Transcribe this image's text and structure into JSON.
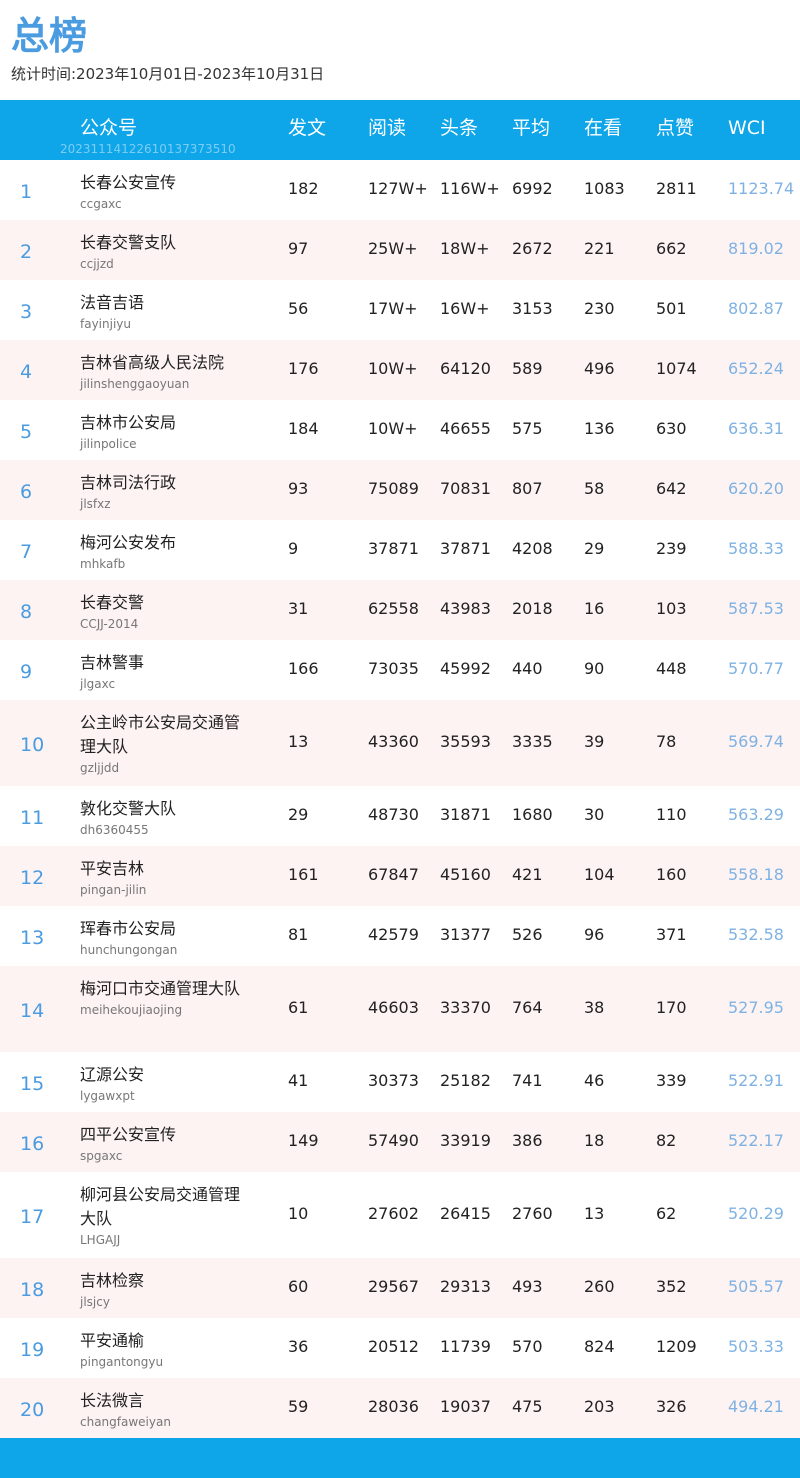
{
  "header": {
    "title": "总榜",
    "period": "统计时间:2023年10月01日-2023年10月31日"
  },
  "table": {
    "columns": {
      "account": "公众号",
      "posts": "发文",
      "reads": "阅读",
      "headline": "头条",
      "average": "平均",
      "watching": "在看",
      "likes": "点赞",
      "wci": "WCI"
    },
    "watermark": "20231114122610137373510",
    "rows": [
      {
        "rank": "1",
        "name": "长春公安宣传",
        "id": "ccgaxc",
        "posts": "182",
        "reads": "127W+",
        "headline": "116W+",
        "average": "6992",
        "watching": "1083",
        "likes": "2811",
        "wci": "1123.74"
      },
      {
        "rank": "2",
        "name": "长春交警支队",
        "id": "ccjjzd",
        "posts": "97",
        "reads": "25W+",
        "headline": "18W+",
        "average": "2672",
        "watching": "221",
        "likes": "662",
        "wci": "819.02"
      },
      {
        "rank": "3",
        "name": "法音吉语",
        "id": "fayinjiyu",
        "posts": "56",
        "reads": "17W+",
        "headline": "16W+",
        "average": "3153",
        "watching": "230",
        "likes": "501",
        "wci": "802.87"
      },
      {
        "rank": "4",
        "name": "吉林省高级人民法院",
        "id": "jilinshenggaoyuan",
        "posts": "176",
        "reads": "10W+",
        "headline": "64120",
        "average": "589",
        "watching": "496",
        "likes": "1074",
        "wci": "652.24"
      },
      {
        "rank": "5",
        "name": "吉林市公安局",
        "id": "jilinpolice",
        "posts": "184",
        "reads": "10W+",
        "headline": "46655",
        "average": "575",
        "watching": "136",
        "likes": "630",
        "wci": "636.31"
      },
      {
        "rank": "6",
        "name": "吉林司法行政",
        "id": "jlsfxz",
        "posts": "93",
        "reads": "75089",
        "headline": "70831",
        "average": "807",
        "watching": "58",
        "likes": "642",
        "wci": "620.20"
      },
      {
        "rank": "7",
        "name": "梅河公安发布",
        "id": "mhkafb",
        "posts": "9",
        "reads": "37871",
        "headline": "37871",
        "average": "4208",
        "watching": "29",
        "likes": "239",
        "wci": "588.33"
      },
      {
        "rank": "8",
        "name": "长春交警",
        "id": "CCJJ-2014",
        "posts": "31",
        "reads": "62558",
        "headline": "43983",
        "average": "2018",
        "watching": "16",
        "likes": "103",
        "wci": "587.53"
      },
      {
        "rank": "9",
        "name": "吉林警事",
        "id": "jlgaxc",
        "posts": "166",
        "reads": "73035",
        "headline": "45992",
        "average": "440",
        "watching": "90",
        "likes": "448",
        "wci": "570.77"
      },
      {
        "rank": "10",
        "name": "公主岭市公安局交通管理大队",
        "id": "gzljjdd",
        "posts": "13",
        "reads": "43360",
        "headline": "35593",
        "average": "3335",
        "watching": "39",
        "likes": "78",
        "wci": "569.74"
      },
      {
        "rank": "11",
        "name": "敦化交警大队",
        "id": "dh6360455",
        "posts": "29",
        "reads": "48730",
        "headline": "31871",
        "average": "1680",
        "watching": "30",
        "likes": "110",
        "wci": "563.29"
      },
      {
        "rank": "12",
        "name": "平安吉林",
        "id": "pingan-jilin",
        "posts": "161",
        "reads": "67847",
        "headline": "45160",
        "average": "421",
        "watching": "104",
        "likes": "160",
        "wci": "558.18"
      },
      {
        "rank": "13",
        "name": "珲春市公安局",
        "id": "hunchungongan",
        "posts": "81",
        "reads": "42579",
        "headline": "31377",
        "average": "526",
        "watching": "96",
        "likes": "371",
        "wci": "532.58"
      },
      {
        "rank": "14",
        "name": "梅河口市交通管理大队",
        "id": "meihekoujiaojing",
        "posts": "61",
        "reads": "46603",
        "headline": "33370",
        "average": "764",
        "watching": "38",
        "likes": "170",
        "wci": "527.95"
      },
      {
        "rank": "15",
        "name": "辽源公安",
        "id": "lygawxpt",
        "posts": "41",
        "reads": "30373",
        "headline": "25182",
        "average": "741",
        "watching": "46",
        "likes": "339",
        "wci": "522.91"
      },
      {
        "rank": "16",
        "name": "四平公安宣传",
        "id": "spgaxc",
        "posts": "149",
        "reads": "57490",
        "headline": "33919",
        "average": "386",
        "watching": "18",
        "likes": "82",
        "wci": "522.17"
      },
      {
        "rank": "17",
        "name": "柳河县公安局交通管理大队",
        "id": "LHGAJJ",
        "posts": "10",
        "reads": "27602",
        "headline": "26415",
        "average": "2760",
        "watching": "13",
        "likes": "62",
        "wci": "520.29"
      },
      {
        "rank": "18",
        "name": "吉林检察",
        "id": "jlsjcy",
        "posts": "60",
        "reads": "29567",
        "headline": "29313",
        "average": "493",
        "watching": "260",
        "likes": "352",
        "wci": "505.57"
      },
      {
        "rank": "19",
        "name": "平安通榆",
        "id": "pingantongyu",
        "posts": "36",
        "reads": "20512",
        "headline": "11739",
        "average": "570",
        "watching": "824",
        "likes": "1209",
        "wci": "503.33"
      },
      {
        "rank": "20",
        "name": "长法微言",
        "id": "changfaweiyan",
        "posts": "59",
        "reads": "28036",
        "headline": "19037",
        "average": "475",
        "watching": "203",
        "likes": "326",
        "wci": "494.21"
      }
    ]
  },
  "colors": {
    "accent": "#0ea5e9",
    "title": "#4a9be0",
    "wci": "#7fb2e3",
    "alt_row": "#fdf3f3"
  }
}
